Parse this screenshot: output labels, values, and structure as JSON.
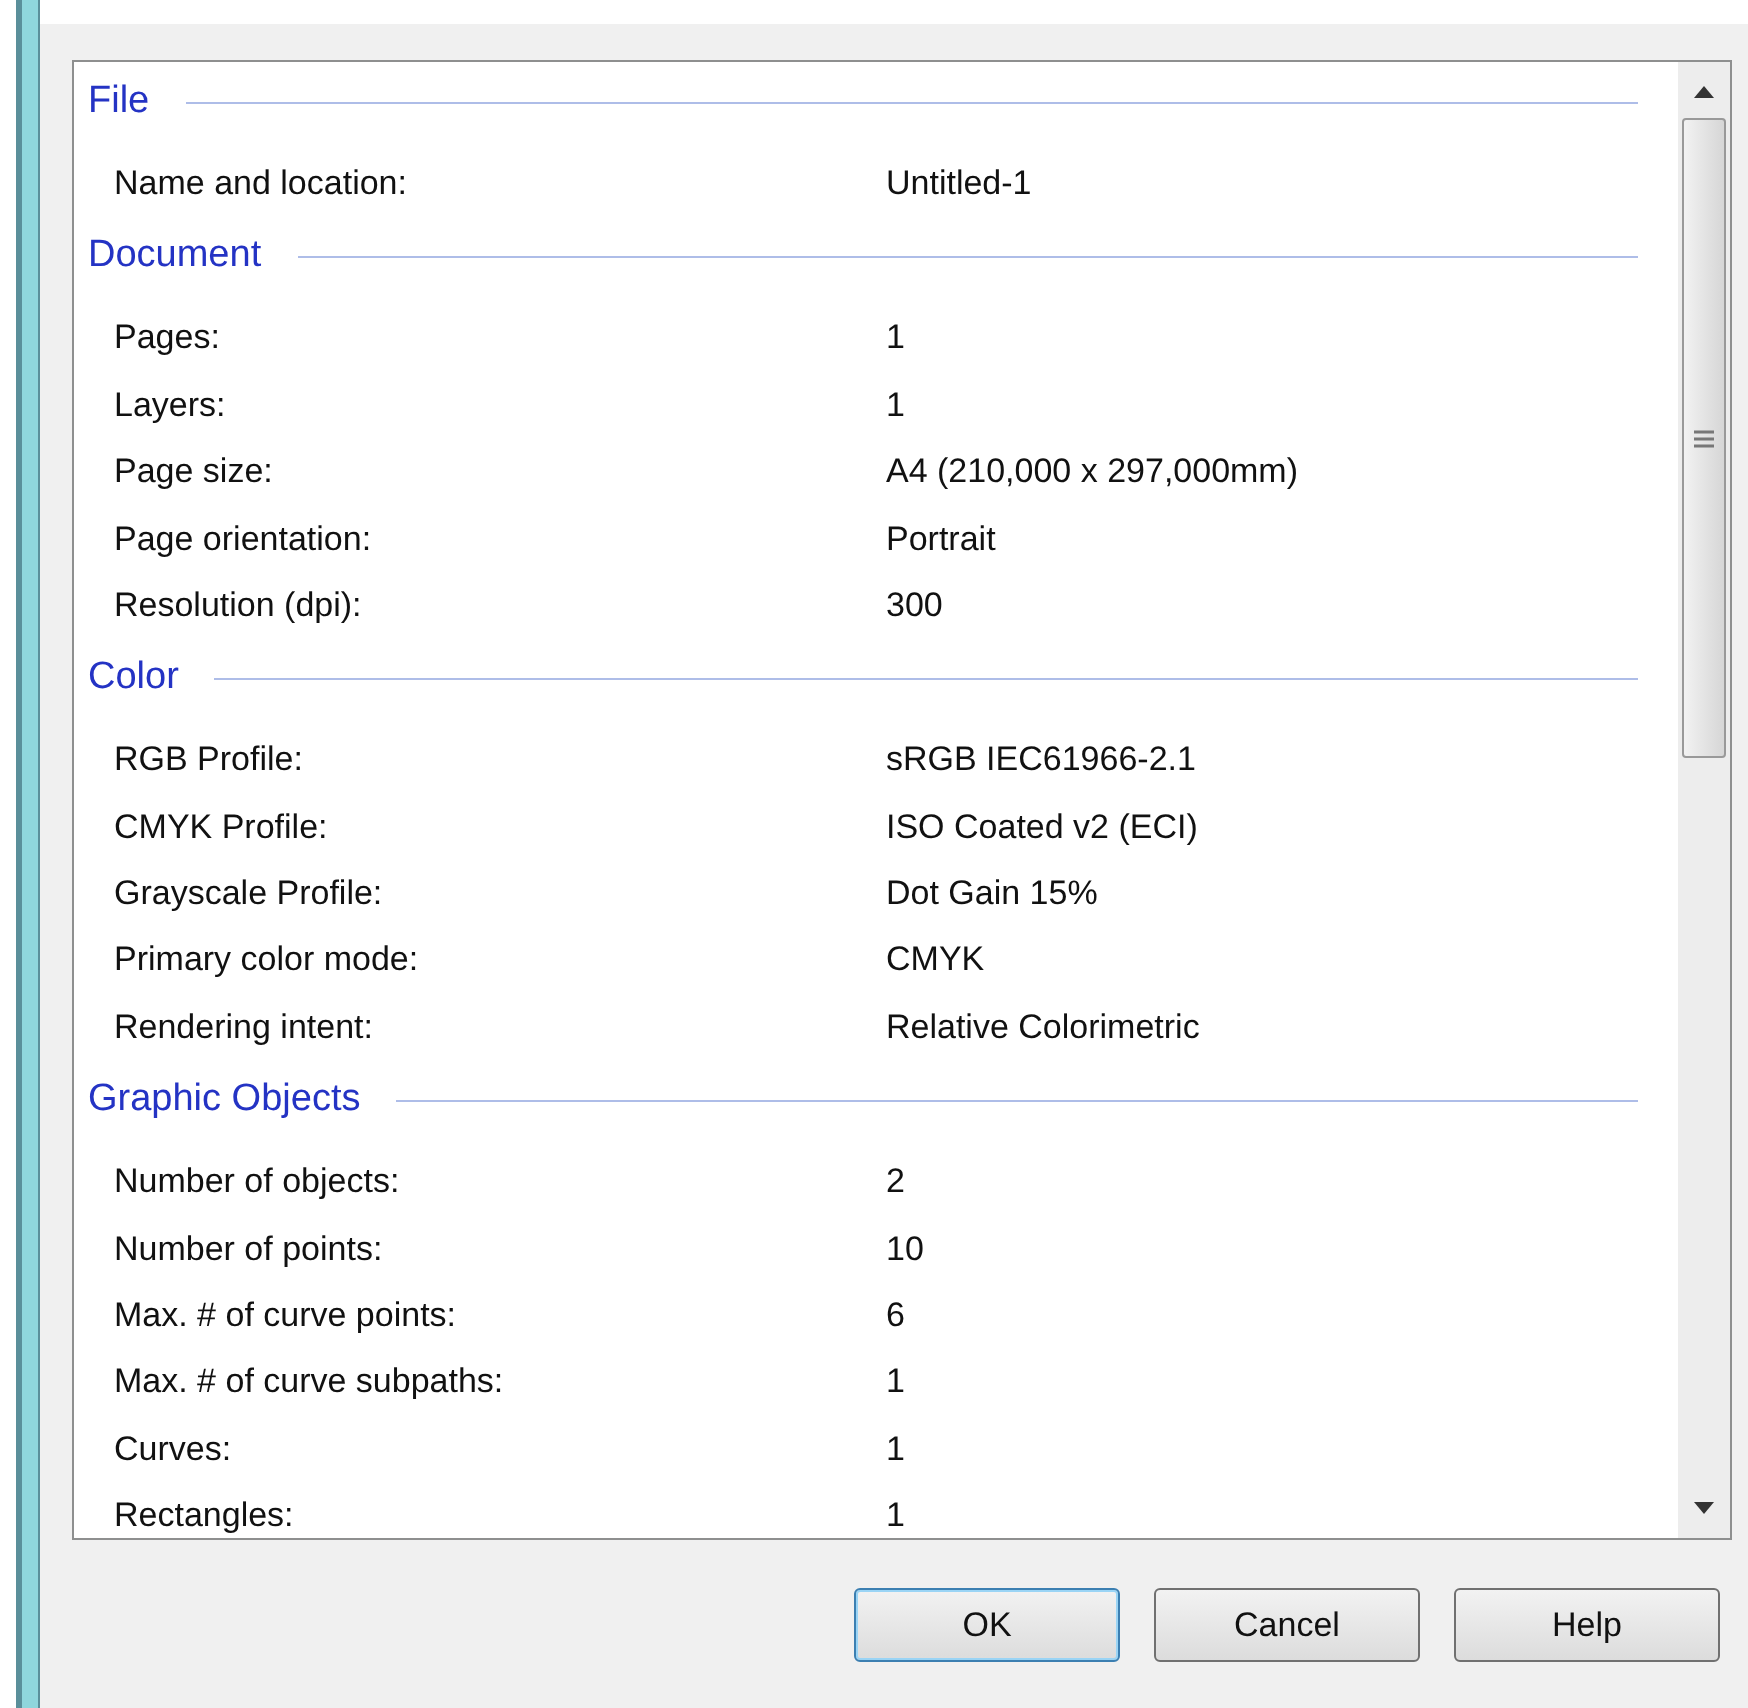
{
  "sections": [
    {
      "title": "File",
      "rows": [
        {
          "label": "Name and location:",
          "value": "Untitled-1"
        }
      ]
    },
    {
      "title": "Document",
      "rows": [
        {
          "label": "Pages:",
          "value": "1"
        },
        {
          "label": "Layers:",
          "value": "1"
        },
        {
          "label": "Page size:",
          "value": "A4 (210,000 x 297,000mm)"
        },
        {
          "label": "Page orientation:",
          "value": "Portrait"
        },
        {
          "label": "Resolution (dpi):",
          "value": "300"
        }
      ]
    },
    {
      "title": "Color",
      "rows": [
        {
          "label": "RGB Profile:",
          "value": "sRGB IEC61966-2.1"
        },
        {
          "label": "CMYK Profile:",
          "value": "ISO Coated v2 (ECI)"
        },
        {
          "label": "Grayscale Profile:",
          "value": "Dot Gain 15%"
        },
        {
          "label": "Primary color mode:",
          "value": "CMYK"
        },
        {
          "label": "Rendering intent:",
          "value": "Relative Colorimetric"
        }
      ]
    },
    {
      "title": "Graphic Objects",
      "rows": [
        {
          "label": "Number of objects:",
          "value": "2"
        },
        {
          "label": "Number of points:",
          "value": "10"
        },
        {
          "label": "Max. # of curve points:",
          "value": "6"
        },
        {
          "label": "Max. # of curve subpaths:",
          "value": "1"
        },
        {
          "label": "Curves:",
          "value": "1"
        },
        {
          "label": "Rectangles:",
          "value": "1"
        }
      ]
    }
  ],
  "buttons": [
    {
      "label": "OK",
      "default": true
    },
    {
      "label": "Cancel",
      "default": false
    },
    {
      "label": "Help",
      "default": false
    }
  ]
}
